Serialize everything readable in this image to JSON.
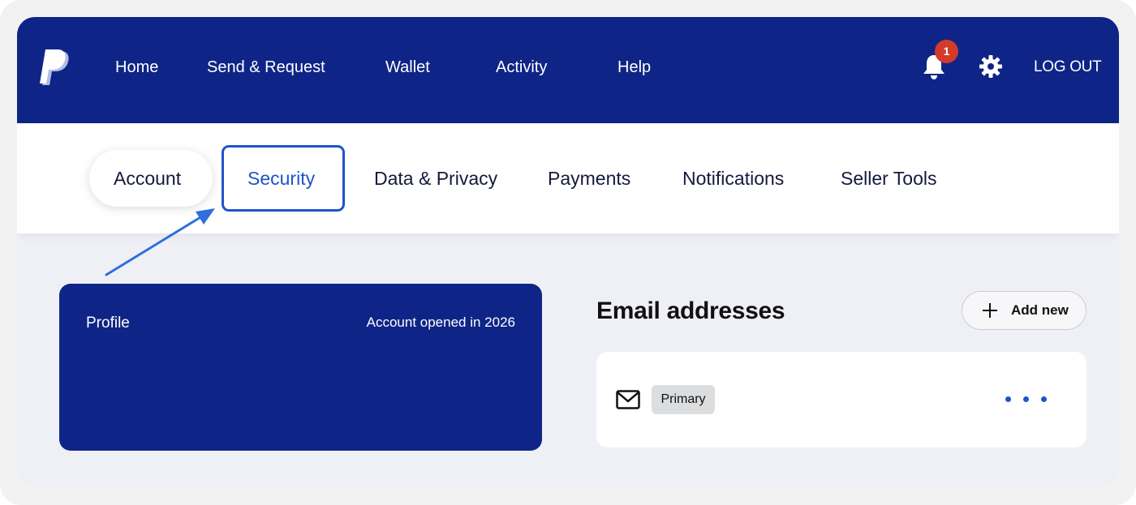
{
  "header": {
    "nav": [
      {
        "label": "Home"
      },
      {
        "label": "Send & Request"
      },
      {
        "label": "Wallet"
      },
      {
        "label": "Activity"
      },
      {
        "label": "Help"
      }
    ],
    "notification_count": "1",
    "logout_label": "LOG OUT"
  },
  "tabs": [
    {
      "label": "Account",
      "state": "current"
    },
    {
      "label": "Security",
      "state": "highlighted"
    },
    {
      "label": "Data & Privacy"
    },
    {
      "label": "Payments"
    },
    {
      "label": "Notifications"
    },
    {
      "label": "Seller Tools"
    }
  ],
  "profile": {
    "title": "Profile",
    "opened": "Account opened in 2026"
  },
  "email_section": {
    "heading": "Email addresses",
    "add_new_label": "Add new",
    "emails": [
      {
        "badge": "Primary"
      }
    ]
  },
  "colors": {
    "brand_navy": "#0e2587",
    "accent_blue": "#1f54c9",
    "badge_red": "#d43a2a",
    "page_bg": "#eef0f6"
  },
  "icons": {
    "logo": "paypal-logo-icon",
    "notifications": "bell-icon",
    "settings": "gear-icon",
    "add": "plus-icon",
    "email": "envelope-icon",
    "more": "more-dots-icon"
  }
}
